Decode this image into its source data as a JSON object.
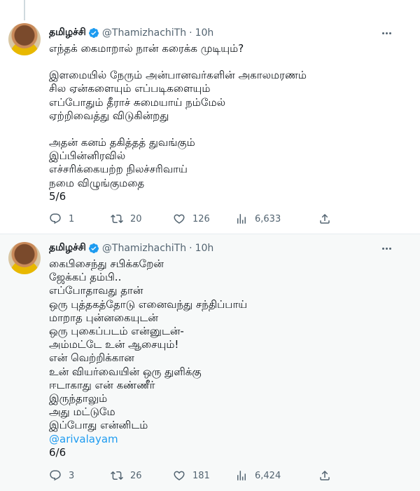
{
  "tweets": [
    {
      "author_name": "தமிழச்சி",
      "handle": "@ThamizhachiTh",
      "separator": "·",
      "time": "10h",
      "lines": [
        "எந்தக் கைமாறால் நான் கரைக்க முடியும்?",
        "",
        "இளமையில் நேரும் அன்பானவர்களின் அகாலமரணம்",
        "சில ஏன்களையும் எப்படிகளையும்",
        "எப்போதும் தீராச் சுமையாய் நம்மேல்",
        "ஏற்றிவைத்து விடுகின்றது",
        "",
        "அதன் கனம் தகித்தத் துவங்கும்",
        "இப்பின்னிரவில்",
        "எச்சரிக்கையற்ற நிலச்சரிவாய்",
        "நமை விழுங்குமதை",
        "5/6"
      ],
      "replies": "1",
      "retweets": "20",
      "likes": "126",
      "views": "6,633"
    },
    {
      "author_name": "தமிழச்சி",
      "handle": "@ThamizhachiTh",
      "separator": "·",
      "time": "10h",
      "lines": [
        "கைபிசைந்து சபிக்கறேன்",
        "ஜேக்கப் தம்பி..",
        "எப்போதாவது தான்",
        "ஒரு புத்தகத்தோடு எனைவந்து சந்திப்பாய்",
        "மாறாத புன்னகையுடன்",
        "ஒரு புகைப்படம் என்னுடன்-",
        "அம்மட்டே உன் ஆசையும்!",
        "என் வெற்றிக்கான",
        "உன் வியர்வையின் ஒரு துளிக்கு",
        "ஈடாகாது என் கண்ணீர்",
        "இருந்தாலும்",
        "அது மட்டுமே",
        "இப்போது என்னிடம்"
      ],
      "mention": "@arivalayam",
      "footer": "6/6",
      "replies": "3",
      "retweets": "26",
      "likes": "181",
      "views": "6,424"
    }
  ],
  "icons": [
    "reply-icon",
    "retweet-icon",
    "like-icon",
    "views-icon",
    "share-icon",
    "more-icon",
    "verified-icon"
  ],
  "colors": {
    "accent": "#1d9bf0",
    "muted": "#536471",
    "divider": "#e6ecf0",
    "highlight_bg": "#f7f9f9"
  }
}
